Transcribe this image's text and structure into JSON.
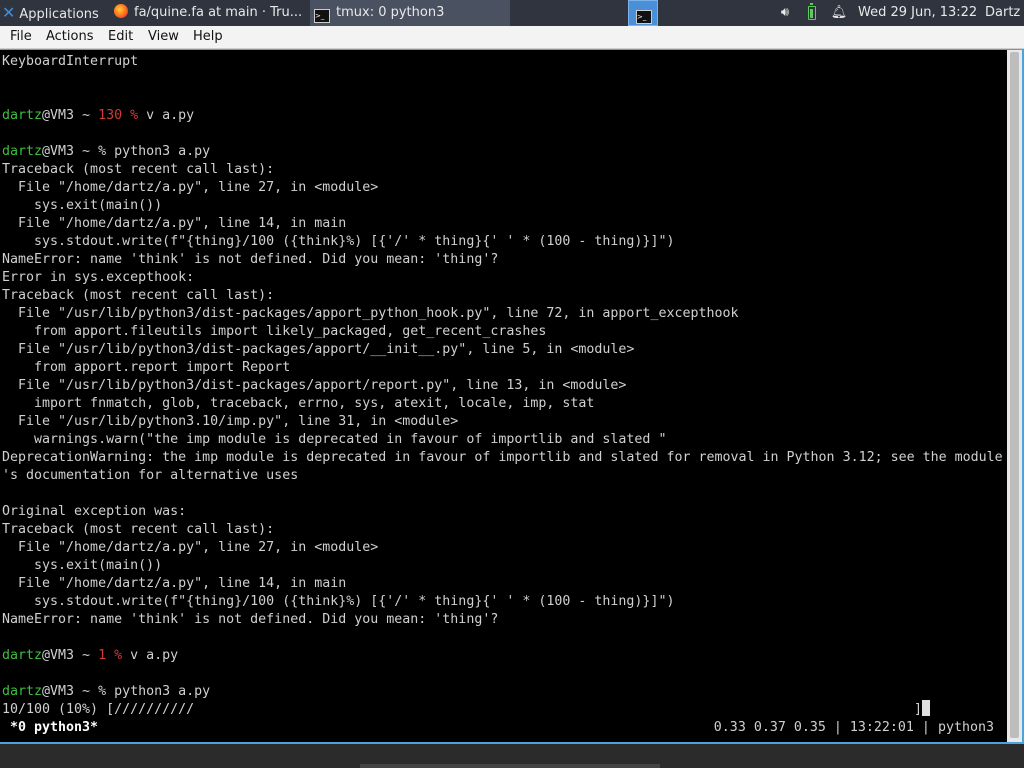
{
  "panel": {
    "applications_label": "Applications",
    "tasks": [
      {
        "label": "fa/quine.fa at main · Tru..."
      },
      {
        "label": "tmux: 0 python3"
      }
    ],
    "clock": "Wed 29 Jun, 13:22",
    "user": "Dartz"
  },
  "menubar": {
    "file": "File",
    "actions": "Actions",
    "edit": "Edit",
    "view": "View",
    "help": "Help"
  },
  "terminal": {
    "lines": [
      {
        "segments": [
          {
            "text": "KeyboardInterrupt",
            "cls": ""
          }
        ]
      },
      {
        "segments": []
      },
      {
        "segments": []
      },
      {
        "segments": [
          {
            "text": "dartz",
            "cls": "g"
          },
          {
            "text": "@VM3 ~ ",
            "cls": ""
          },
          {
            "text": "130 %",
            "cls": "r"
          },
          {
            "text": " v a.py",
            "cls": ""
          }
        ]
      },
      {
        "segments": []
      },
      {
        "segments": [
          {
            "text": "dartz",
            "cls": "g"
          },
          {
            "text": "@VM3 ~ % python3 a.py",
            "cls": ""
          }
        ]
      },
      {
        "segments": [
          {
            "text": "Traceback (most recent call last):",
            "cls": ""
          }
        ]
      },
      {
        "segments": [
          {
            "text": "  File \"/home/dartz/a.py\", line 27, in <module>",
            "cls": ""
          }
        ]
      },
      {
        "segments": [
          {
            "text": "    sys.exit(main())",
            "cls": ""
          }
        ]
      },
      {
        "segments": [
          {
            "text": "  File \"/home/dartz/a.py\", line 14, in main",
            "cls": ""
          }
        ]
      },
      {
        "segments": [
          {
            "text": "    sys.stdout.write(f\"{thing}/100 ({think}%) [{'/' * thing}{' ' * (100 - thing)}]\")",
            "cls": ""
          }
        ]
      },
      {
        "segments": [
          {
            "text": "NameError: name 'think' is not defined. Did you mean: 'thing'?",
            "cls": ""
          }
        ]
      },
      {
        "segments": [
          {
            "text": "Error in sys.excepthook:",
            "cls": ""
          }
        ]
      },
      {
        "segments": [
          {
            "text": "Traceback (most recent call last):",
            "cls": ""
          }
        ]
      },
      {
        "segments": [
          {
            "text": "  File \"/usr/lib/python3/dist-packages/apport_python_hook.py\", line 72, in apport_excepthook",
            "cls": ""
          }
        ]
      },
      {
        "segments": [
          {
            "text": "    from apport.fileutils import likely_packaged, get_recent_crashes",
            "cls": ""
          }
        ]
      },
      {
        "segments": [
          {
            "text": "  File \"/usr/lib/python3/dist-packages/apport/__init__.py\", line 5, in <module>",
            "cls": ""
          }
        ]
      },
      {
        "segments": [
          {
            "text": "    from apport.report import Report",
            "cls": ""
          }
        ]
      },
      {
        "segments": [
          {
            "text": "  File \"/usr/lib/python3/dist-packages/apport/report.py\", line 13, in <module>",
            "cls": ""
          }
        ]
      },
      {
        "segments": [
          {
            "text": "    import fnmatch, glob, traceback, errno, sys, atexit, locale, imp, stat",
            "cls": ""
          }
        ]
      },
      {
        "segments": [
          {
            "text": "  File \"/usr/lib/python3.10/imp.py\", line 31, in <module>",
            "cls": ""
          }
        ]
      },
      {
        "segments": [
          {
            "text": "    warnings.warn(\"the imp module is deprecated in favour of importlib and slated \"",
            "cls": ""
          }
        ]
      },
      {
        "segments": [
          {
            "text": "DeprecationWarning: the imp module is deprecated in favour of importlib and slated for removal in Python 3.12; see the module",
            "cls": ""
          }
        ]
      },
      {
        "segments": [
          {
            "text": "'s documentation for alternative uses",
            "cls": ""
          }
        ]
      },
      {
        "segments": []
      },
      {
        "segments": [
          {
            "text": "Original exception was:",
            "cls": ""
          }
        ]
      },
      {
        "segments": [
          {
            "text": "Traceback (most recent call last):",
            "cls": ""
          }
        ]
      },
      {
        "segments": [
          {
            "text": "  File \"/home/dartz/a.py\", line 27, in <module>",
            "cls": ""
          }
        ]
      },
      {
        "segments": [
          {
            "text": "    sys.exit(main())",
            "cls": ""
          }
        ]
      },
      {
        "segments": [
          {
            "text": "  File \"/home/dartz/a.py\", line 14, in main",
            "cls": ""
          }
        ]
      },
      {
        "segments": [
          {
            "text": "    sys.stdout.write(f\"{thing}/100 ({think}%) [{'/' * thing}{' ' * (100 - thing)}]\")",
            "cls": ""
          }
        ]
      },
      {
        "segments": [
          {
            "text": "NameError: name 'think' is not defined. Did you mean: 'thing'?",
            "cls": ""
          }
        ]
      },
      {
        "segments": []
      },
      {
        "segments": [
          {
            "text": "dartz",
            "cls": "g"
          },
          {
            "text": "@VM3 ~ ",
            "cls": ""
          },
          {
            "text": "1 %",
            "cls": "r"
          },
          {
            "text": " v a.py",
            "cls": ""
          }
        ]
      },
      {
        "segments": []
      },
      {
        "segments": [
          {
            "text": "dartz",
            "cls": "g"
          },
          {
            "text": "@VM3 ~ % python3 a.py",
            "cls": ""
          }
        ]
      },
      {
        "segments": [
          {
            "text": "10/100 (10%) [//////////",
            "cls": ""
          }
        ]
      }
    ],
    "cursor_bracket": "]"
  },
  "tmux": {
    "window_label": "*0 python3*",
    "right_status": "0.33 0.37 0.35 | 13:22:01 | python3"
  },
  "colors": {
    "prompt_user": "#3fbf3f",
    "error_code": "#d23a3a",
    "terminal_bg": "#000000",
    "terminal_fg": "#d0d0d0",
    "panel_bg": "#2f343f"
  }
}
